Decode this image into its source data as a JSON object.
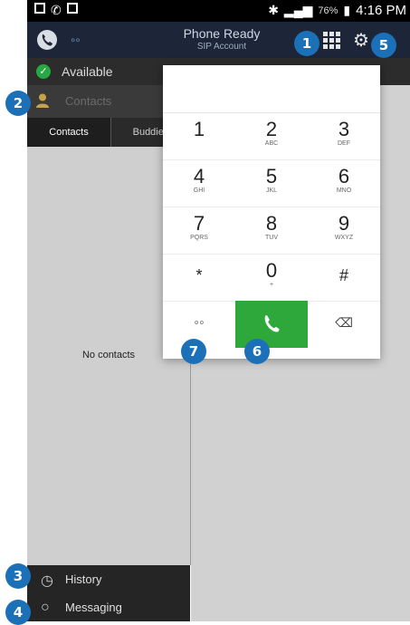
{
  "status_bar": {
    "time": "4:16 PM",
    "battery": "76%"
  },
  "top_bar": {
    "title": "Phone Ready",
    "subtitle": "SIP Account"
  },
  "presence": {
    "label": "Available",
    "color": "#27a844"
  },
  "contacts_panel": {
    "header": "Contacts",
    "tabs": [
      "Contacts",
      "Buddies"
    ],
    "empty_text": "No contacts"
  },
  "bottom_nav": {
    "history": "History",
    "messaging": "Messaging"
  },
  "dialpad": {
    "keys": [
      {
        "num": "1",
        "letters": ""
      },
      {
        "num": "2",
        "letters": "ABC"
      },
      {
        "num": "3",
        "letters": "DEF"
      },
      {
        "num": "4",
        "letters": "GHI"
      },
      {
        "num": "5",
        "letters": "JKL"
      },
      {
        "num": "6",
        "letters": "MNO"
      },
      {
        "num": "7",
        "letters": "PQRS"
      },
      {
        "num": "8",
        "letters": "TUV"
      },
      {
        "num": "9",
        "letters": "WXYZ"
      },
      {
        "num": "*",
        "letters": ""
      },
      {
        "num": "0",
        "letters": "+"
      },
      {
        "num": "#",
        "letters": ""
      }
    ],
    "call_color": "#2ea83a"
  },
  "badges": [
    "1",
    "2",
    "3",
    "4",
    "5",
    "6",
    "7"
  ],
  "colors": {
    "badge": "#1b70b8",
    "top_bar": "#1c2638"
  }
}
